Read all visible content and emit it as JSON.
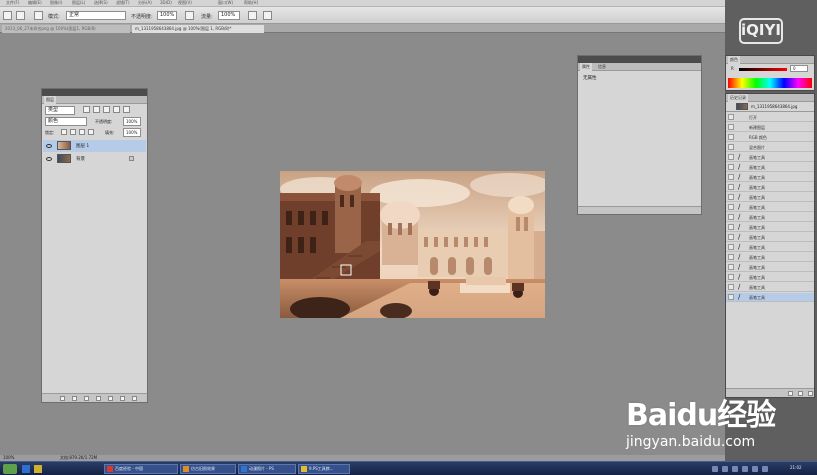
{
  "menubar": {
    "items": [
      "文件(F)",
      "编辑(E)",
      "图像(I)",
      "图层(L)",
      "选择(S)",
      "滤镜(T)",
      "分析(A)",
      "3D(D)",
      "视图(V)",
      "窗口(W)",
      "帮助(H)"
    ]
  },
  "options": {
    "mode_label": "模式:",
    "mode_value": "正常",
    "opacity_label": "不透明度:",
    "opacity_value": "100%",
    "flow_label": "流量:",
    "flow_value": "100%"
  },
  "tabs": [
    {
      "label": "2013_06_27未命名png @ 100%(图层1, RGB/8)"
    },
    {
      "label": "m_1311958643864.jpg @ 100%(图层 1, RGB/8)*"
    }
  ],
  "layers_panel": {
    "title": "图层",
    "kind_label": "类型",
    "blend_value": "颜色",
    "opacity_label": "不透明度:",
    "opacity_value": "100%",
    "lock_label": "锁定:",
    "fill_label": "填充:",
    "fill_value": "100%",
    "layers": [
      {
        "name": "图层 1",
        "selected": true
      },
      {
        "name": "背景",
        "selected": false
      }
    ]
  },
  "properties_panel": {
    "tabs": [
      "属性",
      "信息"
    ],
    "content": "无属性"
  },
  "color_panel": {
    "tab": "颜色",
    "r_label": "R",
    "r_value": "0"
  },
  "history_panel": {
    "tabs": [
      "历史记录"
    ],
    "snapshot": "m_1311958643864.jpg",
    "items": [
      {
        "label": "打开",
        "brush": false,
        "selected": false
      },
      {
        "label": "新建图层",
        "brush": false,
        "selected": false
      },
      {
        "label": "RGB 颜色",
        "brush": false,
        "selected": false
      },
      {
        "label": "混合图片",
        "brush": false,
        "selected": false
      },
      {
        "label": "画笔工具",
        "brush": true,
        "selected": false
      },
      {
        "label": "画笔工具",
        "brush": true,
        "selected": false
      },
      {
        "label": "画笔工具",
        "brush": true,
        "selected": false
      },
      {
        "label": "画笔工具",
        "brush": true,
        "selected": false
      },
      {
        "label": "画笔工具",
        "brush": true,
        "selected": false
      },
      {
        "label": "画笔工具",
        "brush": true,
        "selected": false
      },
      {
        "label": "画笔工具",
        "brush": true,
        "selected": false
      },
      {
        "label": "画笔工具",
        "brush": true,
        "selected": false
      },
      {
        "label": "画笔工具",
        "brush": true,
        "selected": false
      },
      {
        "label": "画笔工具",
        "brush": true,
        "selected": false
      },
      {
        "label": "画笔工具",
        "brush": true,
        "selected": false
      },
      {
        "label": "画笔工具",
        "brush": true,
        "selected": false
      },
      {
        "label": "画笔工具",
        "brush": true,
        "selected": false
      },
      {
        "label": "画笔工具",
        "brush": true,
        "selected": false
      },
      {
        "label": "画笔工具",
        "brush": true,
        "selected": true
      }
    ]
  },
  "status": {
    "zoom": "100%",
    "doc": "文档:879.2K/1.72M"
  },
  "taskbar": {
    "buttons": [
      "百度经验 - 中国",
      "仿古旧照效果",
      "动漫照片 - PS",
      "9.PS工具教..."
    ],
    "clock": "21:02"
  },
  "watermark": {
    "iqiyi": "iQIYI",
    "baidu_logo": "Baidu经验",
    "baidu_url": "jingyan.baidu.com"
  },
  "colors": {
    "workspace": "#8b8b8b",
    "panel": "#d6d6d6",
    "selected": "#b6cbe8",
    "taskbar": "#1c2d55"
  }
}
